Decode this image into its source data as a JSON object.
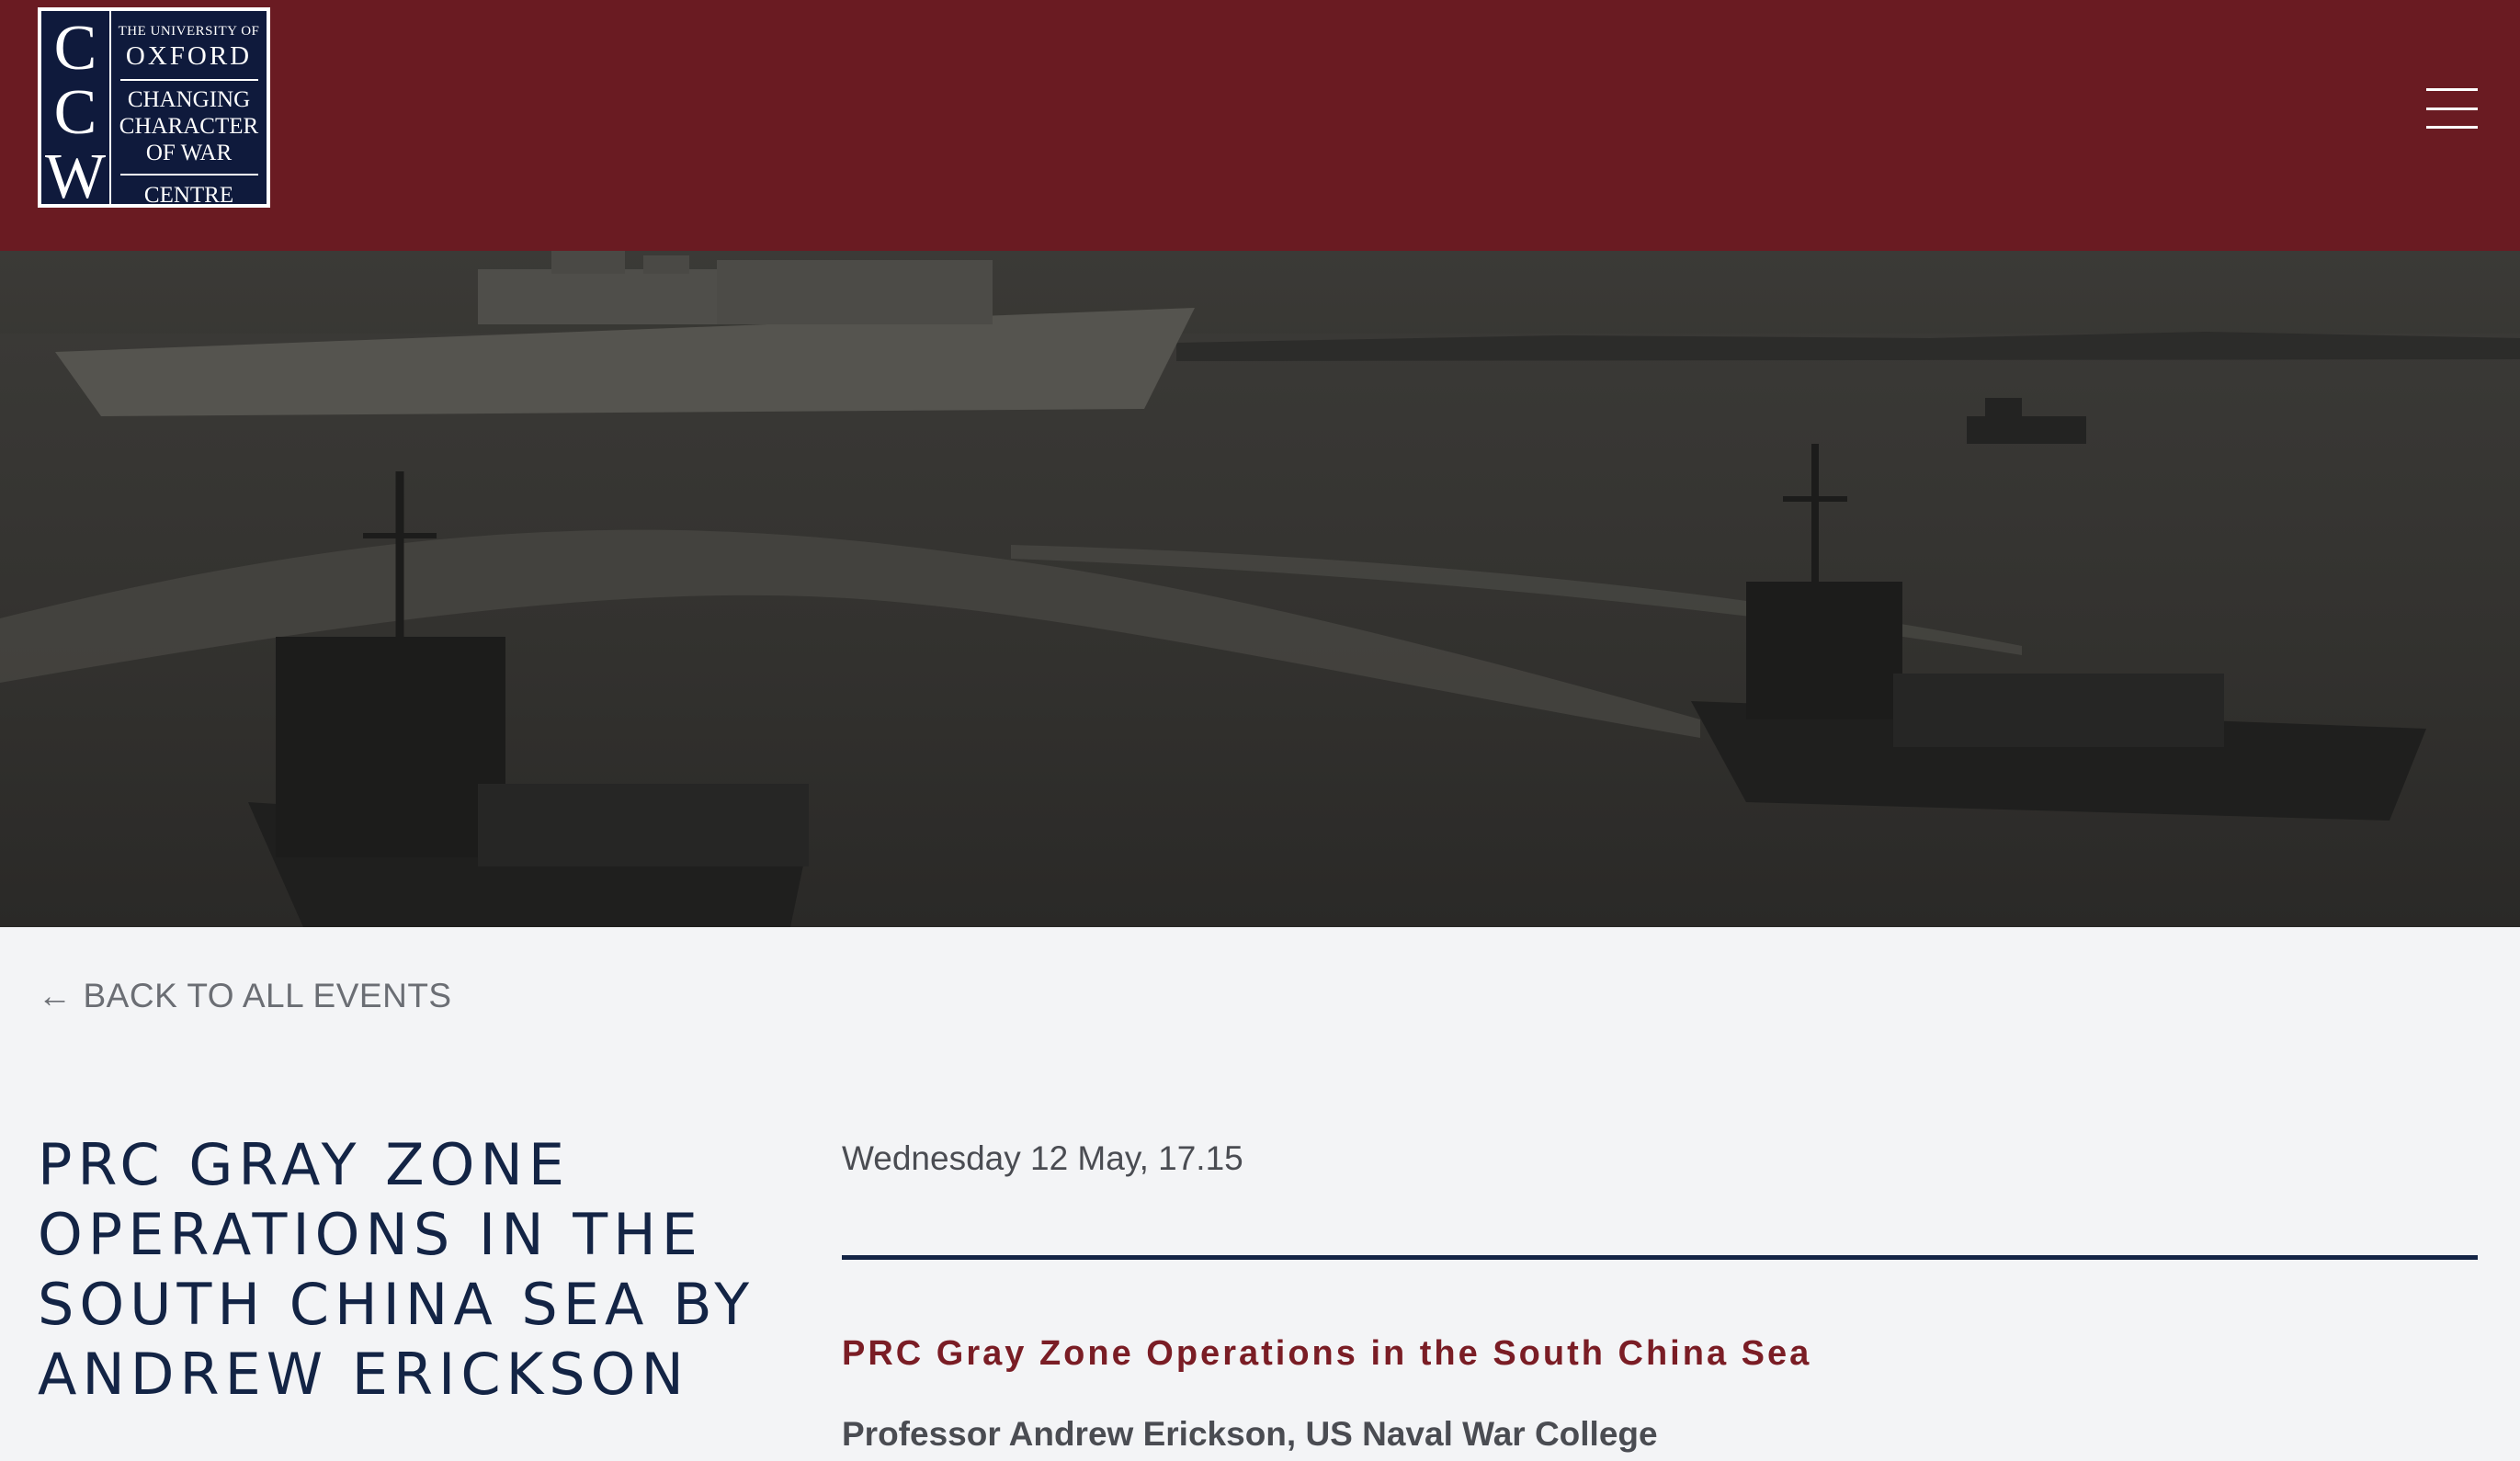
{
  "header": {
    "logo": {
      "letters": [
        "C",
        "C",
        "W"
      ],
      "top": "THE UNIVERSITY OF",
      "oxford": "OXFORD",
      "lines": [
        "CHANGING",
        "CHARACTER",
        "OF WAR"
      ],
      "centre": "CENTRE"
    },
    "menu_icon": "hamburger-menu-icon"
  },
  "hero": {
    "image": "naval-vessels-photo"
  },
  "content": {
    "back_label": "BACK TO ALL EVENTS",
    "back_icon": "arrow-left-icon",
    "title": "PRC GRAY ZONE OPERATIONS IN THE SOUTH CHINA SEA BY ANDREW ERICKSON",
    "date": "Wednesday 12 May, 17.15",
    "subtitle": "PRC Gray Zone Operations in the South China Sea",
    "speaker": "Professor Andrew Erickson, US Naval War College"
  },
  "colors": {
    "header_bg": "#6a1b22",
    "title_text": "#132445",
    "accent": "#7a1d25",
    "page_bg": "#f3f4f6"
  }
}
